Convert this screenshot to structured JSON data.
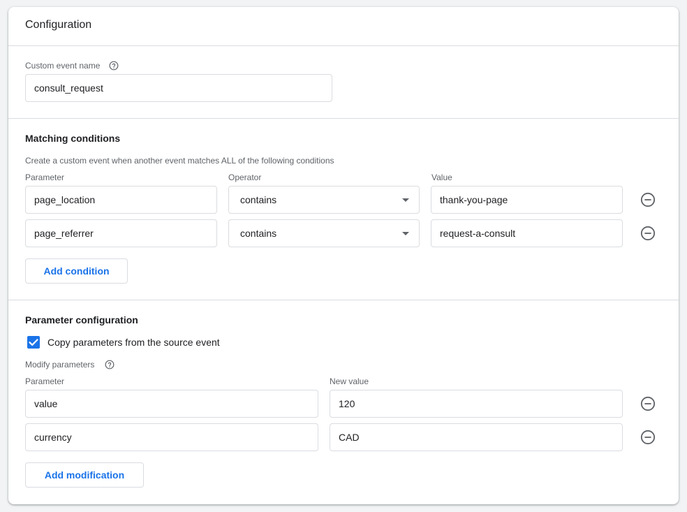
{
  "card": {
    "title": "Configuration"
  },
  "event_name": {
    "label": "Custom event name",
    "value": "consult_request"
  },
  "matching": {
    "title": "Matching conditions",
    "description": "Create a custom event when another event matches ALL of the following conditions",
    "col_parameter": "Parameter",
    "col_operator": "Operator",
    "col_value": "Value",
    "rows": [
      {
        "parameter": "page_location",
        "operator": "contains",
        "value": "thank-you-page"
      },
      {
        "parameter": "page_referrer",
        "operator": "contains",
        "value": "request-a-consult"
      }
    ],
    "add_label": "Add condition"
  },
  "param_config": {
    "title": "Parameter configuration",
    "copy_label": "Copy parameters from the source event",
    "copy_checked": true,
    "modify_label": "Modify parameters",
    "col_parameter": "Parameter",
    "col_new_value": "New value",
    "rows": [
      {
        "parameter": "value",
        "new_value": "120"
      },
      {
        "parameter": "currency",
        "new_value": "CAD"
      }
    ],
    "add_label": "Add modification"
  },
  "colors": {
    "accent": "#1a73e8",
    "border": "#dadce0",
    "muted": "#5f6368"
  },
  "icons": {
    "help": "help-circle-icon",
    "remove": "remove-circle-icon",
    "check": "check-icon",
    "caret": "caret-down-icon"
  }
}
